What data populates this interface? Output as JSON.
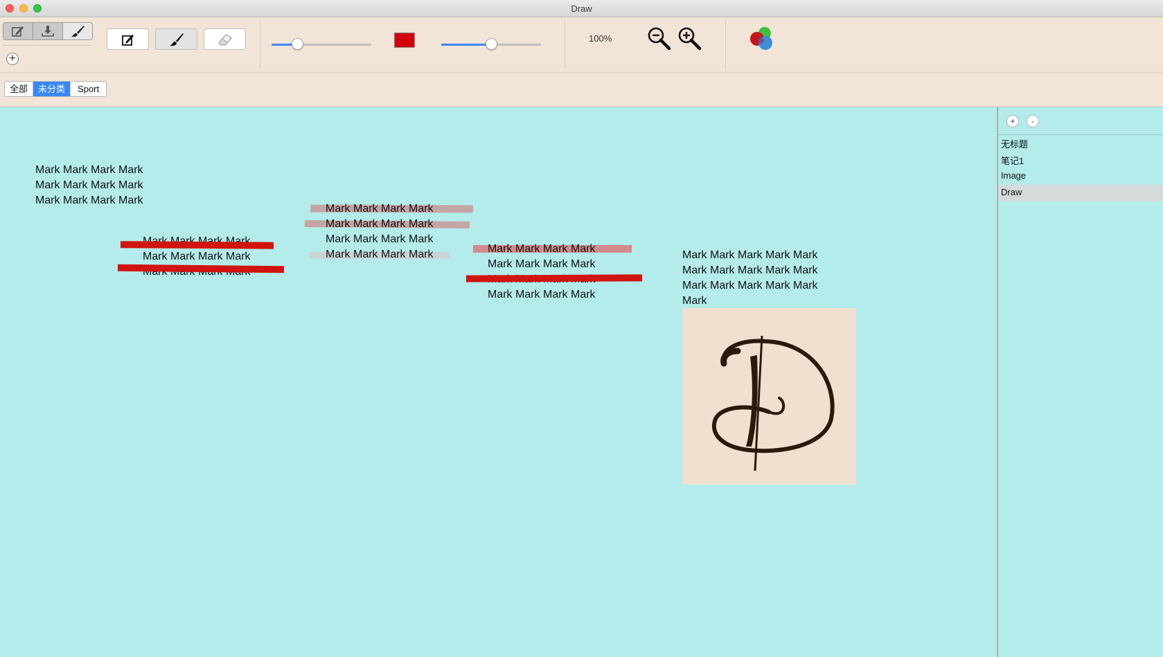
{
  "window": {
    "title": "Draw"
  },
  "toolbar": {
    "segment_icons": [
      "edit-icon",
      "download-icon",
      "brush-icon"
    ],
    "tools": [
      "edit-tool",
      "brush-tool",
      "eraser-tool"
    ],
    "size_slider_value": 0.26,
    "opacity_slider_value": 0.5,
    "stroke_color": "#d0000c",
    "zoom_level": "100%"
  },
  "tabs": [
    "全部",
    "未分类",
    "Sport"
  ],
  "sidebar": {
    "add_button": "+",
    "remove_button": "-",
    "items": [
      "无标题",
      "笔记1",
      "Image",
      "Draw"
    ]
  },
  "canvas": {
    "mark_line": "Mark Mark Mark Mark",
    "mark_line_5": "Mark Mark Mark Mark Mark",
    "mark_word": "Mark"
  }
}
